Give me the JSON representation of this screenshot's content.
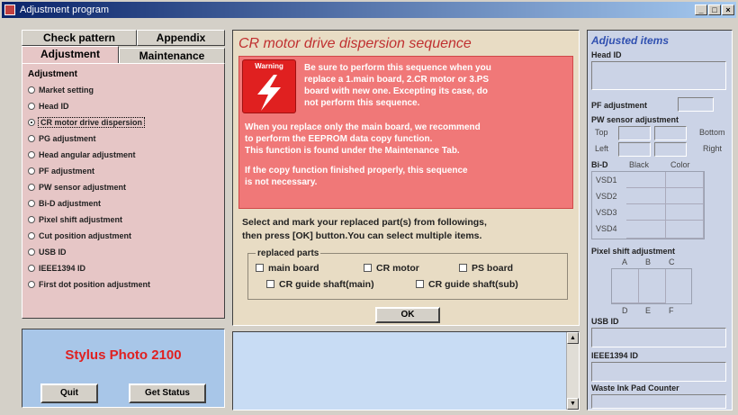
{
  "window": {
    "title": "Adjustment program",
    "min": "_",
    "max": "□",
    "close": "×"
  },
  "tabs": {
    "row1": [
      "Check pattern",
      "Appendix"
    ],
    "row2": [
      "Adjustment",
      "Maintenance"
    ]
  },
  "adjustment": {
    "group_label": "Adjustment",
    "items": [
      "Market setting",
      "Head ID",
      "CR motor drive dispersion",
      "PG adjustment",
      "Head angular adjustment",
      "PF adjustment",
      "PW sensor adjustment",
      "Bi-D adjustment",
      "Pixel shift adjustment",
      "Cut position adjustment",
      "USB ID",
      "IEEE1394 ID",
      "First dot position adjustment"
    ],
    "selected_index": 2
  },
  "model": {
    "name": "Stylus Photo 2100",
    "quit": "Quit",
    "get_status": "Get Status"
  },
  "center": {
    "title": "CR motor drive dispersion sequence",
    "warning_label": "Warning",
    "warning_lines": [
      "Be sure to perform this sequence when you",
      "replace a 1.main board, 2.CR motor or 3.PS",
      "board with new one. Excepting its case, do",
      "not perform this sequence."
    ],
    "note_lines": [
      "When you replace only the main board, we recommend",
      "to perform the EEPROM data copy function.",
      "This function is found under the Maintenance Tab."
    ],
    "note2_lines": [
      "If the copy function finished properly, this sequence",
      "is not necessary."
    ],
    "instruction_lines": [
      "Select and mark your replaced part(s) from followings,",
      "then press [OK] button.You can select multiple items."
    ],
    "parts_label": "replaced parts",
    "parts": [
      "main board",
      "CR motor",
      "PS board",
      "CR guide shaft(main)",
      "CR guide shaft(sub)"
    ],
    "ok": "OK"
  },
  "right": {
    "title": "Adjusted items",
    "head_id": "Head ID",
    "pf": "PF adjustment",
    "pw": "PW sensor adjustment",
    "pw_labels": {
      "top": "Top",
      "bottom": "Bottom",
      "left": "Left",
      "right": "Right"
    },
    "bid": "Bi-D",
    "bid_black": "Black",
    "bid_color": "Color",
    "vsd": [
      "VSD1",
      "VSD2",
      "VSD3",
      "VSD4"
    ],
    "pixel_shift": "Pixel shift adjustment",
    "ps_top": [
      "A",
      "B",
      "C"
    ],
    "ps_bottom": [
      "D",
      "E",
      "F"
    ],
    "usb": "USB ID",
    "ieee": "IEEE1394 ID",
    "waste": "Waste Ink Pad Counter"
  }
}
